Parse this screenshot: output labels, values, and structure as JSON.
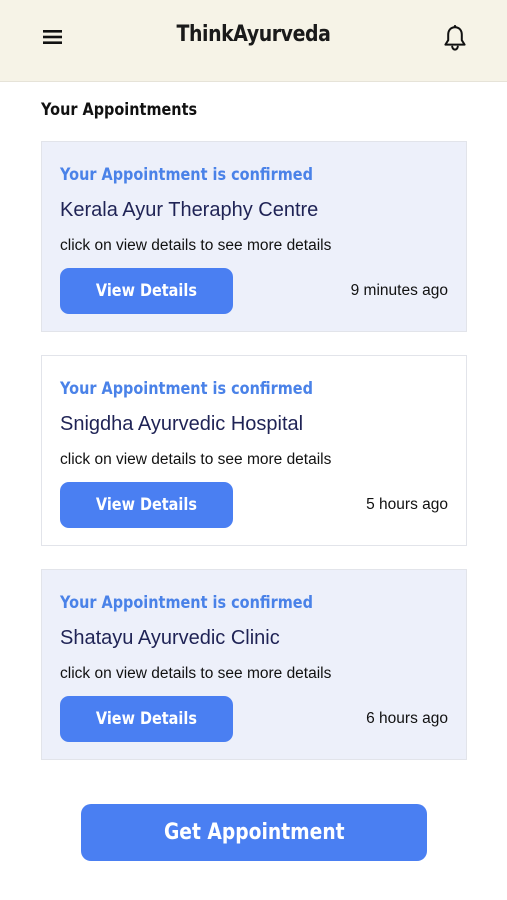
{
  "header": {
    "title": "ThinkAyurveda",
    "menu_icon": "hamburger-menu-icon",
    "notification_icon": "bell-icon"
  },
  "section": {
    "title": "Your Appointments"
  },
  "appointments": [
    {
      "status": "Your Appointment is confirmed",
      "name": "Kerala Ayur Theraphy Centre",
      "description": "click on view details to see more details",
      "button_label": "View Details",
      "time": "9 minutes ago"
    },
    {
      "status": "Your Appointment is confirmed",
      "name": "Snigdha Ayurvedic Hospital",
      "description": "click on view details to see more details",
      "button_label": "View Details",
      "time": "5 hours ago"
    },
    {
      "status": "Your Appointment is confirmed",
      "name": "Shatayu Ayurvedic Clinic",
      "description": "click on view details to see more details",
      "button_label": "View Details",
      "time": "6 hours ago"
    }
  ],
  "footer": {
    "get_appointment_label": "Get Appointment"
  },
  "colors": {
    "header_bg": "#f6f3e7",
    "accent_blue": "#4a7ff2",
    "status_blue": "#4a82e8",
    "card_shaded_bg": "#edf0fa",
    "name_navy": "#1f2355"
  }
}
